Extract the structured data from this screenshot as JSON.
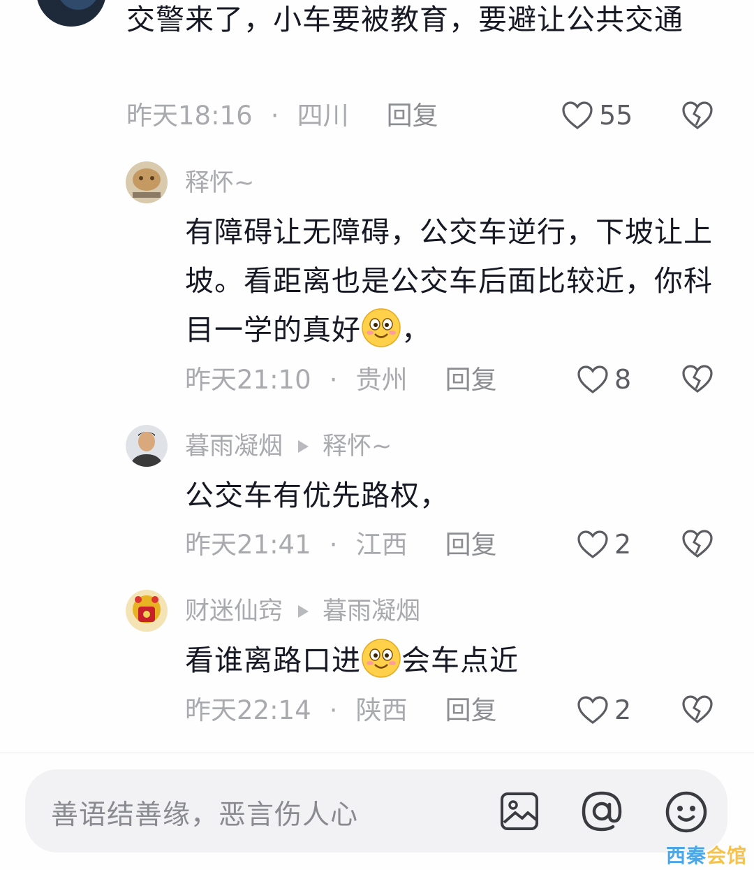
{
  "top_comment": {
    "text": "交警来了，小车要被教育，要避让公共交通",
    "time": "昨天18:16",
    "region": "四川",
    "reply_label": "回复",
    "likes": "55"
  },
  "replies": [
    {
      "username": "释怀~",
      "text_before_emoji": "有障碍让无障碍，公交车逆行，下坡让上坡。看距离也是公交车后面比较近，你科目一学的真好",
      "text_after_emoji": "，",
      "time": "昨天21:10",
      "region": "贵州",
      "reply_label": "回复",
      "likes": "8"
    },
    {
      "username": "暮雨凝烟",
      "reply_to": "释怀~",
      "text": "公交车有优先路权，",
      "time": "昨天21:41",
      "region": "江西",
      "reply_label": "回复",
      "likes": "2"
    },
    {
      "username": "财迷仙窍",
      "reply_to": "暮雨凝烟",
      "text_before_emoji": "看谁离路口进",
      "text_after_emoji": "会车点近",
      "time": "昨天22:14",
      "region": "陕西",
      "reply_label": "回复",
      "likes": "2"
    }
  ],
  "input_bar": {
    "placeholder": "善语结善缘，恶言伤人心",
    "icons": [
      "image-icon",
      "at-icon",
      "emoji-icon"
    ]
  },
  "watermark": {
    "part1": "西秦",
    "part2": "会馆"
  },
  "icons": {
    "like": "heart-outline-icon",
    "dislike": "broken-heart-icon",
    "separator": "dot"
  },
  "colors": {
    "text": "#161823",
    "meta": "#a9aaae",
    "background": "#fefefe",
    "input_bg": "#f2f2f4"
  }
}
